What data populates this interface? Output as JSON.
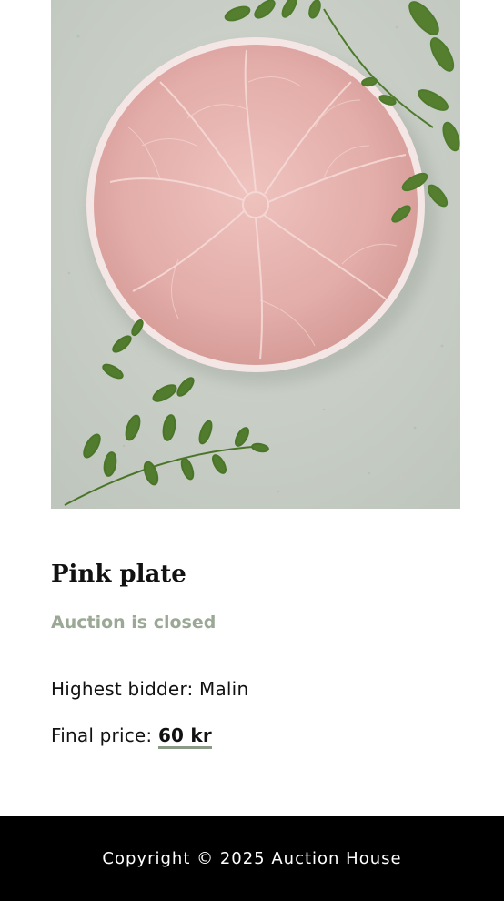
{
  "product": {
    "image_alt": "Pink cabbage leaf plate with fern sprigs on grey stone surface",
    "title": "Pink plate",
    "status": "Auction is closed",
    "bidder_label": "Highest bidder: ",
    "bidder_name": "Malin",
    "price_label": "Final price: ",
    "price_value": "60 kr"
  },
  "footer": {
    "copyright": "Copyright © 2025 Auction House"
  },
  "colors": {
    "status_text": "#9aa895",
    "price_underline": "#8a9a86",
    "footer_bg": "#000000",
    "plate_pink": "#e6b3b0",
    "fern_green": "#4e7a2c",
    "stone_grey": "#c9cfc7"
  }
}
